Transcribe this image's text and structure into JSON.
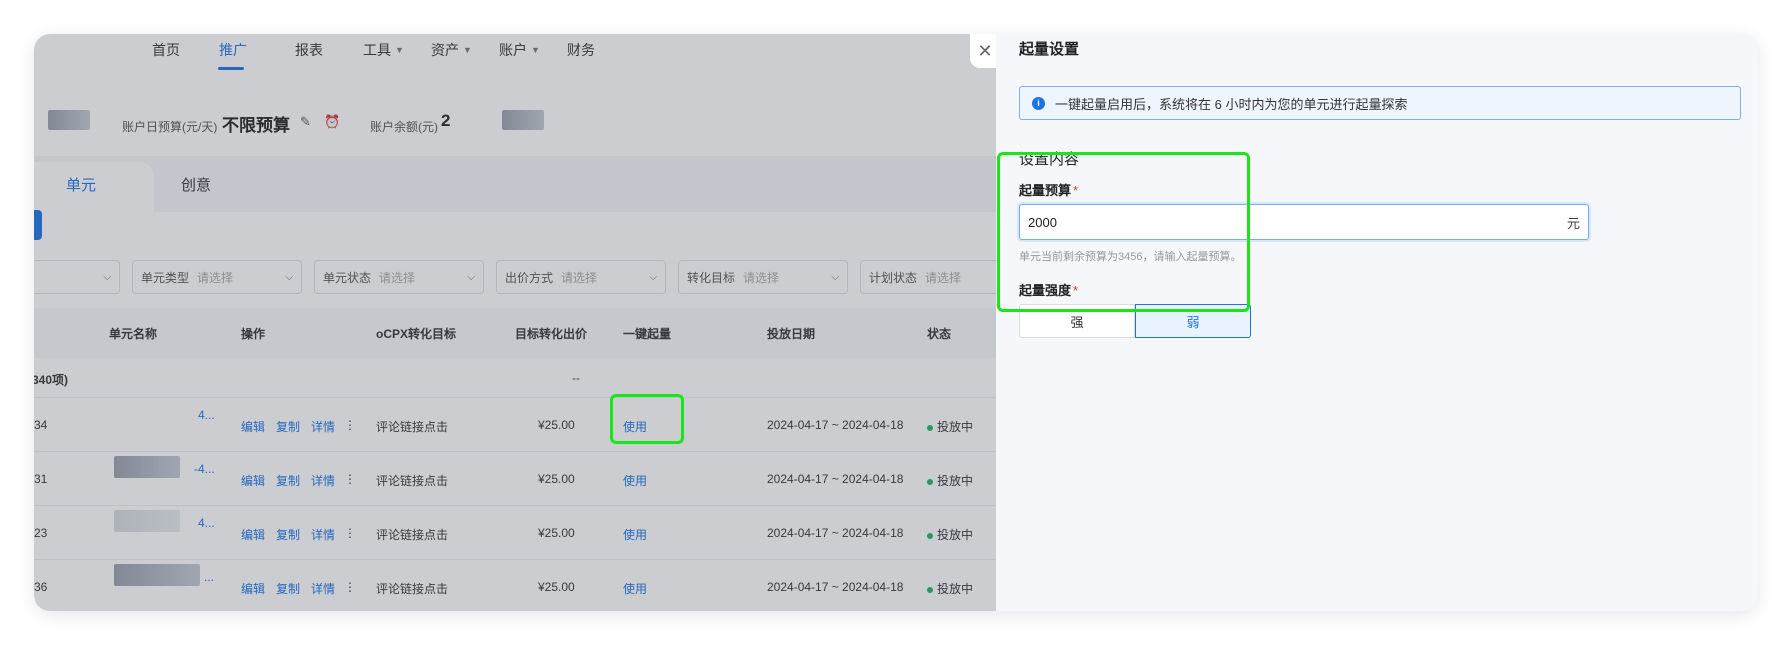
{
  "nav": {
    "items": [
      {
        "label": "首页",
        "dropdown": false
      },
      {
        "label": "推广",
        "dropdown": false,
        "active": true
      },
      {
        "label": "报表",
        "dropdown": false
      },
      {
        "label": "工具",
        "dropdown": true
      },
      {
        "label": "资产",
        "dropdown": true
      },
      {
        "label": "账户",
        "dropdown": true
      },
      {
        "label": "财务",
        "dropdown": false
      }
    ]
  },
  "account": {
    "daily_budget_label": "账户日预算(元/天)",
    "daily_budget_value": "不限预算",
    "balance_label": "账户余额(元)",
    "balance_value": "2"
  },
  "tabs": [
    "单元",
    "创意"
  ],
  "filters": [
    {
      "label": "",
      "placeholder": ""
    },
    {
      "label": "单元类型",
      "placeholder": "请选择"
    },
    {
      "label": "单元状态",
      "placeholder": "请选择"
    },
    {
      "label": "出价方式",
      "placeholder": "请选择"
    },
    {
      "label": "转化目标",
      "placeholder": "请选择"
    },
    {
      "label": "计划状态",
      "placeholder": "请选择"
    }
  ],
  "table": {
    "headers": [
      "单元名称",
      "操作",
      "oCPX转化目标",
      "目标转化出价",
      "一键起量",
      "投放日期",
      "状态"
    ],
    "summary": {
      "count_label": "340项)",
      "bid": "--"
    },
    "actions": {
      "edit": "编辑",
      "copy": "复制",
      "detail": "详情",
      "more": "⋮"
    },
    "rows": [
      {
        "id": "34",
        "name": "4...",
        "target": "评论链接点击",
        "bid": "¥25.00",
        "boost": "使用",
        "date": "2024-04-17 ~ 2024-04-18",
        "status": "投放中"
      },
      {
        "id": "31",
        "name": "-4...",
        "target": "评论链接点击",
        "bid": "¥25.00",
        "boost": "使用",
        "date": "2024-04-17 ~ 2024-04-18",
        "status": "投放中"
      },
      {
        "id": "23",
        "name": "4...",
        "target": "评论链接点击",
        "bid": "¥25.00",
        "boost": "使用",
        "date": "2024-04-17 ~ 2024-04-18",
        "status": "投放中"
      },
      {
        "id": "36",
        "name": "...",
        "target": "评论链接点击",
        "bid": "¥25.00",
        "boost": "使用",
        "date": "2024-04-17 ~ 2024-04-18",
        "status": "投放中"
      }
    ]
  },
  "drawer": {
    "title": "起量设置",
    "notice": "一键起量启用后，系统将在 6 小时内为您的单元进行起量探索",
    "section_title": "设置内容",
    "budget_label": "起量预算",
    "budget_value": "2000",
    "budget_unit": "元",
    "budget_hint": "单元当前剩余预算为3456，请输入起量预算。",
    "strength_label": "起量强度",
    "required_mark": "*",
    "strength_options": [
      "强",
      "弱"
    ],
    "strength_selected": "弱"
  },
  "icons": {
    "close": "close-icon",
    "edit": "pencil-icon",
    "alarm": "alarm-clock-icon",
    "info": "info-icon"
  },
  "colors": {
    "accent": "#1a73e8",
    "highlight": "#19e619",
    "status_active": "#21b36c",
    "required": "#e03131"
  }
}
